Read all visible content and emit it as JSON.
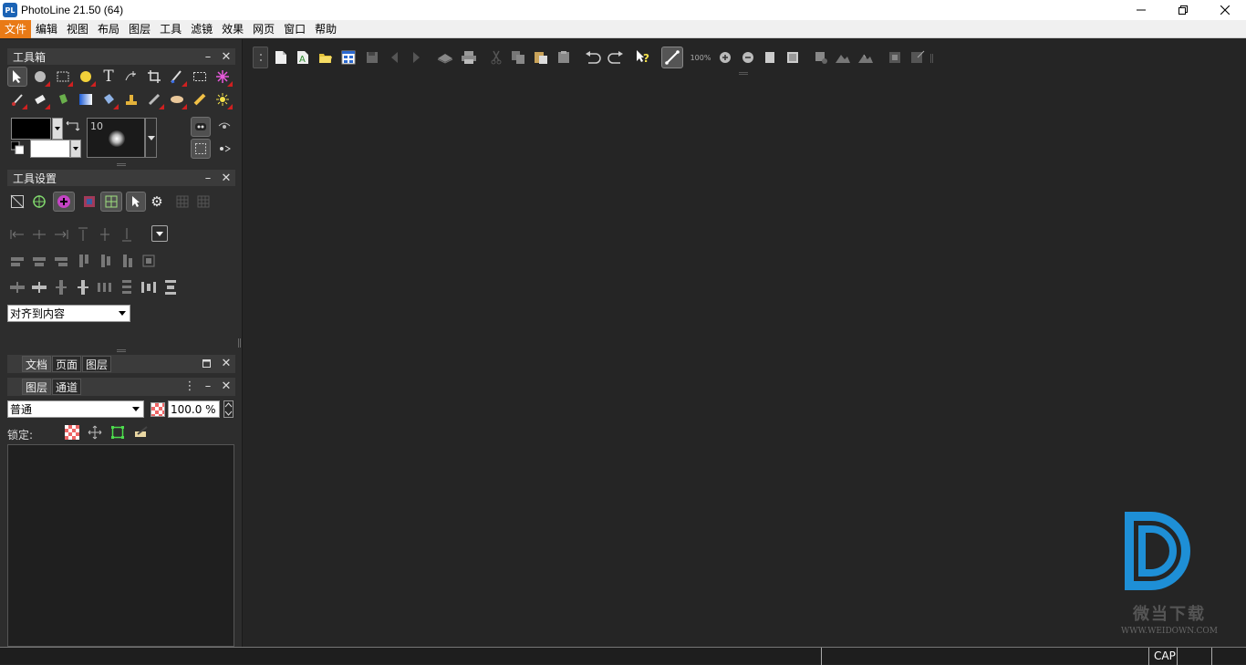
{
  "window": {
    "title": "PhotoLine 21.50 (64)",
    "icon_text": "PL"
  },
  "menu": [
    "文件",
    "编辑",
    "视图",
    "布局",
    "图层",
    "工具",
    "滤镜",
    "效果",
    "网页",
    "窗口",
    "帮助"
  ],
  "toolbox": {
    "title": "工具箱",
    "brush_size": "10"
  },
  "tool_settings": {
    "title": "工具设置",
    "align_select": "对齐到内容"
  },
  "doc_tabs": [
    "文档",
    "页面",
    "图层"
  ],
  "layer_tabs": [
    "图层",
    "通道"
  ],
  "layers": {
    "blend_mode": "普通",
    "opacity": "100.0 %",
    "lock_label": "锁定:"
  },
  "toolbar": {
    "zoom_label": "100%"
  },
  "status": {
    "cap": "CAP"
  },
  "watermark": {
    "brand": "微当下载",
    "url": "WWW.WEIDOWN.COM"
  },
  "colors": {
    "accent": "#e97a16",
    "panel": "#2d2d2d",
    "canvas": "#252525",
    "logo": "#1e8fd6"
  }
}
